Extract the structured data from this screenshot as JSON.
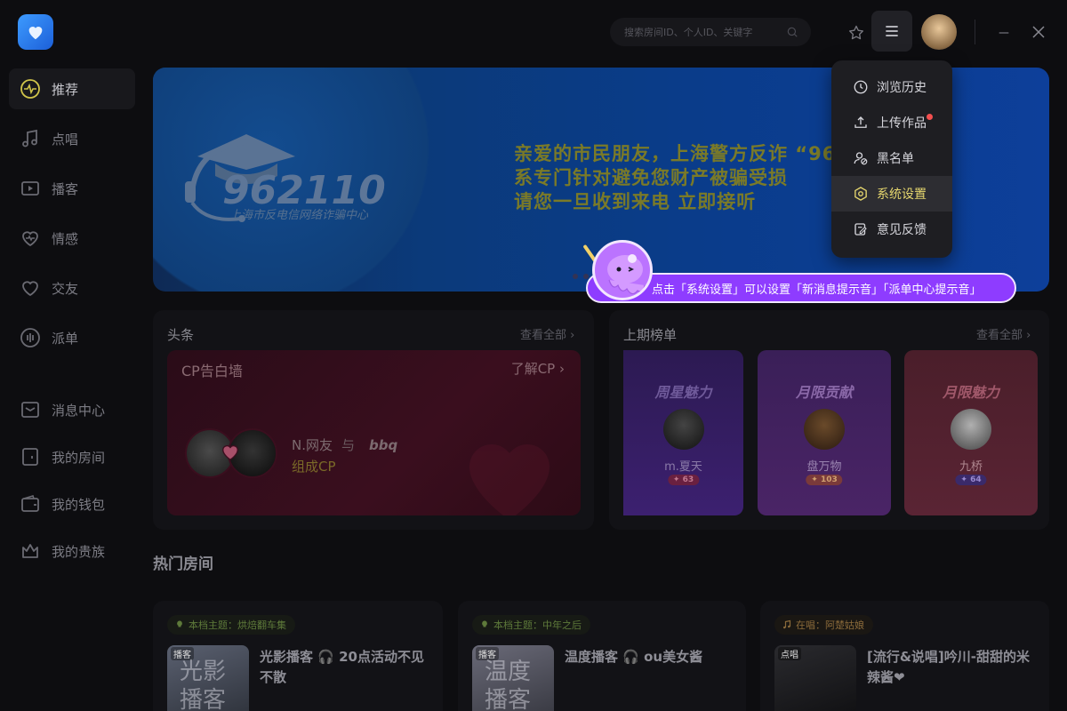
{
  "search": {
    "placeholder": "搜索房间ID、个人ID、关键字"
  },
  "sidebar": {
    "items": [
      {
        "label": "推荐"
      },
      {
        "label": "点唱"
      },
      {
        "label": "播客"
      },
      {
        "label": "情感"
      },
      {
        "label": "交友"
      },
      {
        "label": "派单"
      },
      {
        "label": "消息中心"
      },
      {
        "label": "我的房间"
      },
      {
        "label": "我的钱包"
      },
      {
        "label": "我的贵族"
      }
    ]
  },
  "banner": {
    "hotline": "962110",
    "org_text": "上海市反电信网络诈骗中心",
    "lines": [
      "亲爱的市民朋友，上海警方反诈 “962110”",
      "系专门针对避免您财产被骗受损",
      "请您一旦收到来电 立即接听"
    ]
  },
  "headlines": {
    "title": "头条",
    "more": "查看全部",
    "cp_wall": {
      "title": "CP告白墙",
      "link": "了解CP",
      "name_a": "N.网友",
      "conj": "与",
      "name_b": "bbq",
      "status": "组成CP"
    }
  },
  "ranking": {
    "title": "上期榜单",
    "more": "查看全部",
    "cards": [
      {
        "title": "周星魅力",
        "name": "m.夏天",
        "badge": "63",
        "title_color": "#a88bd6",
        "bg": "#3a1f6e"
      },
      {
        "title": "月限贡献",
        "name": "盘万物",
        "badge": "103",
        "title_color": "#c79be8",
        "bg": "#4a2260"
      },
      {
        "title": "月限魅力",
        "name": "九桥",
        "badge": "64",
        "title_color": "#e58a9c",
        "bg": "#5a2430"
      }
    ]
  },
  "hot_rooms": {
    "title": "热门房间",
    "rooms": [
      {
        "tag": "本档主题：烘焙翻车集",
        "label": "播客",
        "cover": "光影\n播客",
        "name": "光影播客 🎧 20点活动不见不散"
      },
      {
        "tag": "本档主题：中年之后",
        "label": "播客",
        "cover": "温度\n播客",
        "name": "温度播客 🎧 ou美女酱"
      },
      {
        "tag": "在唱：阿楚姑娘",
        "label": "点唱",
        "cover": "",
        "name": "[流行&说唱]吟川-甜甜的米辣酱❤"
      }
    ]
  },
  "dropdown": {
    "items": [
      {
        "label": "浏览历史",
        "icon": "clock-icon"
      },
      {
        "label": "上传作品",
        "icon": "upload-icon"
      },
      {
        "label": "黑名单",
        "icon": "blacklist-icon"
      },
      {
        "label": "系统设置",
        "icon": "settings-icon"
      },
      {
        "label": "意见反馈",
        "icon": "feedback-icon"
      }
    ]
  },
  "tooltip": {
    "text": "点击「系统设置」可以设置「新消息提示音」「派单中心提示音」"
  },
  "colors": {
    "accent": "#e5d66e",
    "tooltip": "#8e3cff",
    "badge_red": "#f34f4f"
  }
}
